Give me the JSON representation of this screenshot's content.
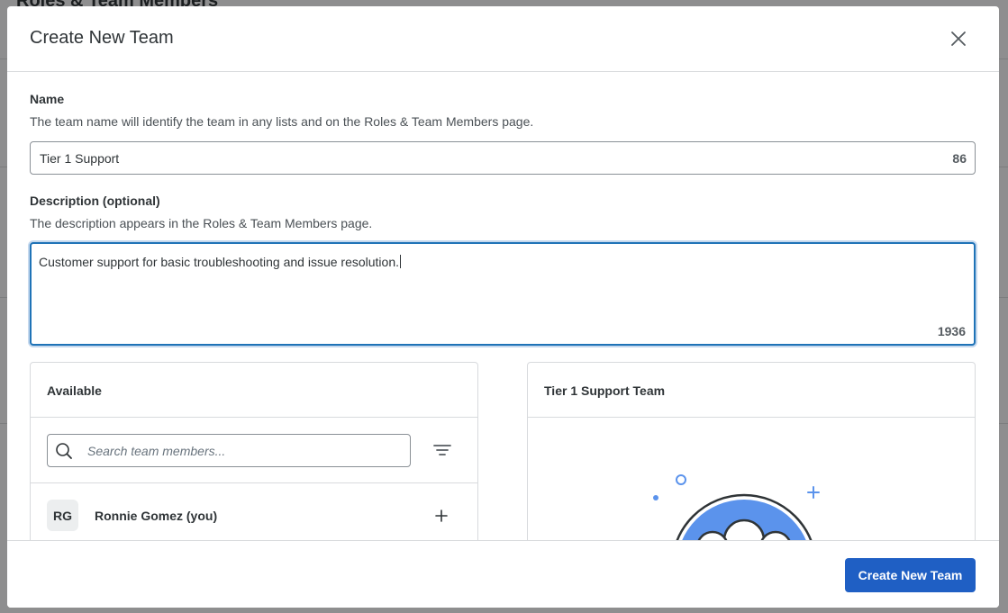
{
  "background": {
    "page_title": "Roles & Team Members"
  },
  "modal": {
    "title": "Create New Team",
    "close_icon": "close-icon"
  },
  "name_field": {
    "label": "Name",
    "help": "The team name will identify the team in any lists and on the Roles & Team Members page.",
    "value": "Tier 1 Support",
    "remaining": "86"
  },
  "description_field": {
    "label": "Description (optional)",
    "help": "The description appears in the Roles & Team Members page.",
    "value": "Customer support for basic troubleshooting and issue resolution.",
    "remaining": "1936"
  },
  "available_panel": {
    "title": "Available",
    "search_placeholder": "Search team members...",
    "search_icon": "search-icon",
    "filter_icon": "filter-icon",
    "members": [
      {
        "initials": "RG",
        "name": "Ronnie Gomez (you)",
        "action_icon": "plus-icon"
      }
    ]
  },
  "team_panel": {
    "title": "Tier 1 Support Team",
    "accent_color": "#5b93ec"
  },
  "footer": {
    "create_label": "Create New Team",
    "primary_color": "#1f5fc4"
  }
}
